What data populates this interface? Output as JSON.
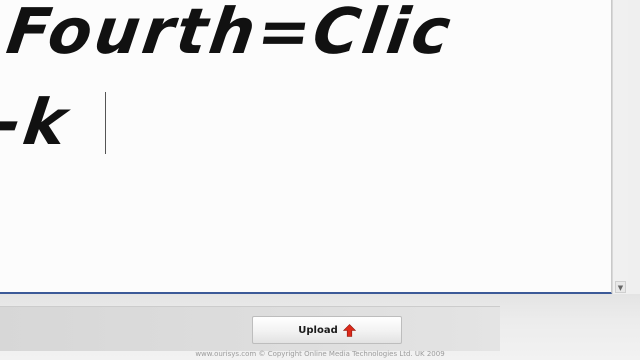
{
  "editor": {
    "lines": [
      "Fourth=Clic",
      "-k"
    ]
  },
  "upload_button": {
    "label": "Upload",
    "icon": "up-arrow-icon",
    "icon_color": "#dd2a1a"
  },
  "footer": {
    "copyright": "www.ourisys.com © Copyright Online Media Technologies Ltd. UK 2009"
  },
  "scrollbar": {
    "down_arrow": "▼"
  },
  "colors": {
    "editor_border": "#3c5a98",
    "editor_background": "#fcfcfc",
    "text": "#111111"
  }
}
